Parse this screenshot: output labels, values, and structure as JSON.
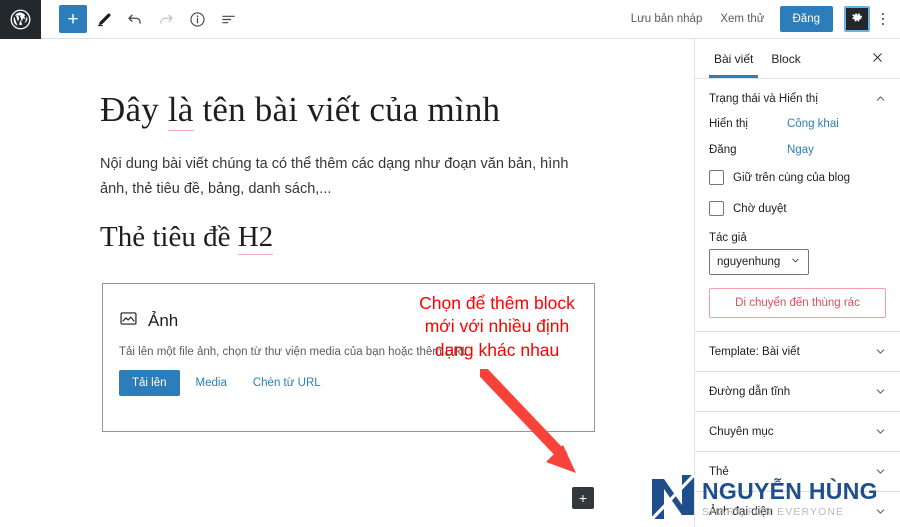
{
  "topbar": {
    "logo_icon": "wordpress-logo",
    "tools": [
      {
        "icon": "plus-icon",
        "name": "add-block-button"
      },
      {
        "icon": "pencil-icon",
        "name": "edit-mode-button"
      },
      {
        "icon": "undo-icon",
        "name": "undo-button"
      },
      {
        "icon": "redo-icon",
        "name": "redo-button"
      },
      {
        "icon": "info-icon",
        "name": "content-info-button"
      },
      {
        "icon": "list-view-icon",
        "name": "list-view-button"
      }
    ],
    "save_draft_label": "Lưu bản nháp",
    "preview_label": "Xem thử",
    "publish_label": "Đăng",
    "settings_icon": "gear-icon",
    "more_icon": "three-dots-vertical-icon",
    "accent_blue": "#2d7dba",
    "dark": "#23282d"
  },
  "editor": {
    "title": "Đây là tên bài viết của mình",
    "title_part_plain_1": "Đây ",
    "title_part_underlined": "là",
    "title_part_plain_2": " tên bài viết của mình",
    "paragraph": "Nội dung bài viết chúng ta có thể thêm các dạng như đoạn văn bản, hình ảnh, thẻ tiêu đề, bảng, danh sách,...",
    "heading_plain": "Thẻ tiêu đề ",
    "heading_underlined": "H2",
    "heading_full": "Thẻ tiêu đề H2",
    "image_block": {
      "icon": "image-icon",
      "title": "Ảnh",
      "description": "Tải lên một file ảnh, chọn từ thư viện media của bạn hoặc thêm URL.",
      "upload_label": "Tải lên",
      "media_label": "Media",
      "url_label": "Chèn từ URL"
    },
    "add_block_plus": "+",
    "annotation": {
      "text": "Chọn để thêm block mới với nhiều định dạng khác nhau",
      "line1": "Chọn để thêm block",
      "line2": "mới với nhiều định",
      "line3": "dạng khác nhau",
      "color": "#ff0000",
      "arrow_icon": "red-arrow-down-right"
    }
  },
  "sidebar": {
    "tabs": [
      {
        "label": "Bài viết",
        "active": true
      },
      {
        "label": "Block",
        "active": false
      }
    ],
    "close_icon": "close-icon",
    "status_panel": {
      "title": "Trạng thái và Hiển thị",
      "collapse_icon": "chevron-up-icon",
      "visibility_label": "Hiển thị",
      "visibility_value": "Công khai",
      "publish_label": "Đăng",
      "publish_value": "Ngay",
      "sticky_label": "Giữ trên cùng của blog",
      "sticky_checked": false,
      "pending_label": "Chờ duyệt",
      "pending_checked": false,
      "author_label": "Tác giả",
      "author_value": "nguyenhung",
      "trash_label": "Di chuyển đến thùng rác",
      "trash_color": "#d94f5c"
    },
    "panels": [
      {
        "title": "Template: Bài viết",
        "icon": "chevron-down-icon"
      },
      {
        "title": "Đường dẫn tĩnh",
        "icon": "chevron-down-icon"
      },
      {
        "title": "Chuyên mục",
        "icon": "chevron-down-icon"
      },
      {
        "title": "Thẻ",
        "icon": "chevron-down-icon"
      },
      {
        "title": "Ảnh đại diện",
        "icon": "chevron-down-icon"
      }
    ]
  },
  "watermark": {
    "logo_icon": "n-monogram-logo",
    "name": "NGUYỄN HÙNG",
    "tagline": "SHARE FOR EVERYONE",
    "color": "#1f4e8c"
  }
}
